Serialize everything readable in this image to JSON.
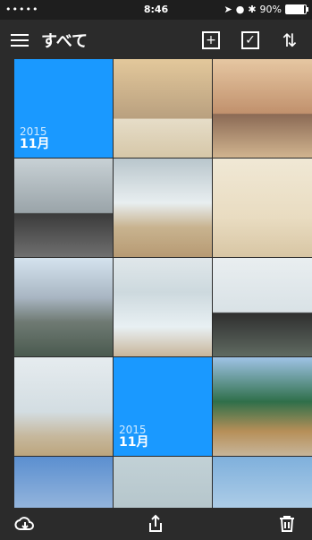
{
  "status_bar": {
    "signal": "•••••",
    "time": "8:46",
    "battery_percent": "90%"
  },
  "header": {
    "title": "すべて",
    "icons": [
      "menu-icon",
      "add-photo-icon",
      "select-check-icon",
      "sort-icon"
    ]
  },
  "grid": {
    "month_cards": [
      {
        "year": "2015",
        "month": "11月"
      },
      {
        "year": "2015",
        "month": "11月"
      }
    ],
    "tiles": [
      {
        "type": "month"
      },
      {
        "type": "photo",
        "desc_color": "#d8b27d"
      },
      {
        "type": "photo",
        "desc_color": "#c78e62"
      },
      {
        "type": "photo",
        "desc_color": "#6e625a"
      },
      {
        "type": "photo",
        "desc_color": "#a7b1b6"
      },
      {
        "type": "photo",
        "desc_color": "#e6d6b3"
      },
      {
        "type": "photo",
        "desc_color": "#8aa2b8"
      },
      {
        "type": "photo",
        "desc_color": "#c5d5dd"
      },
      {
        "type": "photo",
        "desc_color": "#bfc9cd"
      },
      {
        "type": "photo",
        "desc_color": "#d9dde0"
      },
      {
        "type": "month"
      },
      {
        "type": "photo",
        "desc_color": "#6aa48f"
      },
      {
        "type": "photo",
        "desc_color": "#5a86c5"
      },
      {
        "type": "photo",
        "desc_color": "#b9c8cc"
      },
      {
        "type": "photo",
        "desc_color": "#8eb6d8"
      }
    ]
  },
  "bottom_bar": {
    "icons": [
      "cloud-download-icon",
      "share-icon",
      "trash-icon"
    ]
  },
  "colors": {
    "accent": "#1a99ff",
    "bars": "#2b2b2b"
  }
}
